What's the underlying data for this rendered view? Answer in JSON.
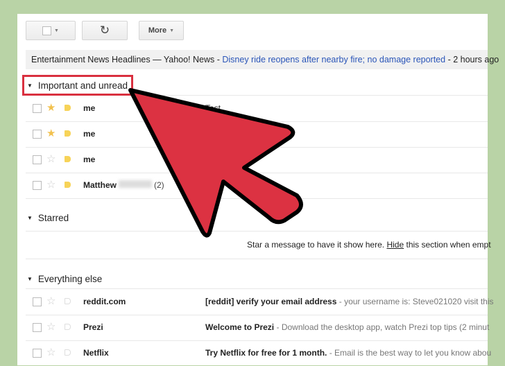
{
  "toolbar": {
    "select_icon": "checkbox-caret",
    "refresh_icon": "refresh-icon",
    "more_label": "More"
  },
  "news": {
    "source": "Entertainment News Headlines — Yahoo! News -",
    "link": "Disney ride reopens after nearby fire; no damage reported",
    "age": "- 2 hours ago"
  },
  "sections": {
    "important": {
      "title": "Important and unread",
      "rows": [
        {
          "from": "me",
          "subject": "Test",
          "starred": true
        },
        {
          "from": "me",
          "subject": "",
          "starred": true
        },
        {
          "from": "me",
          "subject": "",
          "starred": false
        },
        {
          "from": "Matthew",
          "count": "(2)",
          "starred": false
        }
      ]
    },
    "starred": {
      "title": "Starred",
      "empty_pre": "Star a message to have it show here.",
      "hide": "Hide",
      "empty_post": "this section when empt"
    },
    "everything": {
      "title": "Everything else",
      "rows": [
        {
          "from": "reddit.com",
          "subject": "[reddit] verify your email address",
          "snippet": "- your username is: Steve021020 visit this"
        },
        {
          "from": "Prezi",
          "subject": "Welcome to Prezi",
          "snippet": "- Download the desktop app, watch Prezi top tips (2 minut"
        },
        {
          "from": "Netflix",
          "subject": "Try Netflix for free for 1 month.",
          "snippet": "- Email is the best way to let you know abou"
        }
      ]
    }
  },
  "colors": {
    "background": "#b9d3a6",
    "arrow": "#dc3242",
    "highlight": "#d9303f",
    "star": "#f2c14e",
    "label": "#f7d358",
    "link": "#2a55b8"
  }
}
